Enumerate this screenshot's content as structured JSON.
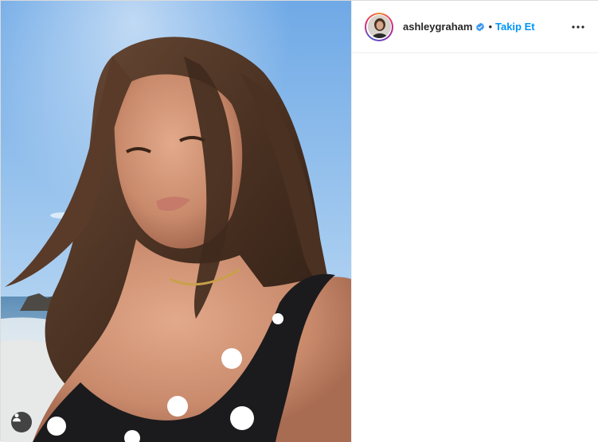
{
  "post": {
    "username": "ashleygraham",
    "separator": "•",
    "follow_label": "Takip Et",
    "verified": true
  },
  "icons": {
    "verified": "verified-badge-icon",
    "more": "more-options-icon",
    "user_tag": "user-tag-icon"
  },
  "colors": {
    "follow_blue": "#0095f6",
    "verified_blue": "#3897f0",
    "text_dark": "#262626"
  }
}
